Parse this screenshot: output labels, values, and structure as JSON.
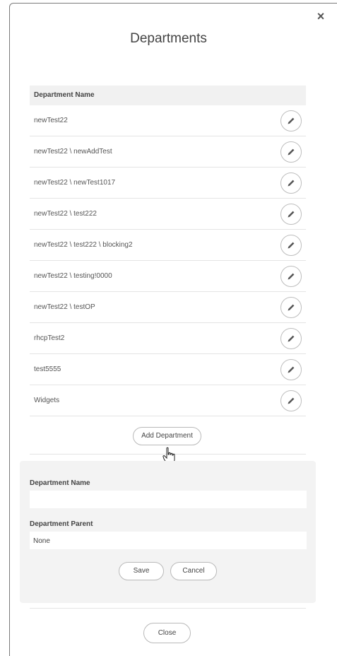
{
  "modal": {
    "title": "Departments",
    "close_icon": "close-x-icon"
  },
  "table": {
    "header": "Department Name",
    "rows": [
      {
        "name": "newTest22"
      },
      {
        "name": "newTest22 \\ newAddTest"
      },
      {
        "name": "newTest22 \\ newTest1017"
      },
      {
        "name": "newTest22 \\ test222"
      },
      {
        "name": "newTest22 \\ test222 \\ blocking2"
      },
      {
        "name": "newTest22 \\ testing!0000"
      },
      {
        "name": "newTest22 \\ testOP"
      },
      {
        "name": "rhcpTest2"
      },
      {
        "name": "test5555"
      },
      {
        "name": "Widgets"
      }
    ],
    "edit_icon": "pencil-icon"
  },
  "actions": {
    "add_label": "Add Department"
  },
  "form": {
    "name_label": "Department Name",
    "name_value": "",
    "parent_label": "Department Parent",
    "parent_value": "None",
    "save_label": "Save",
    "cancel_label": "Cancel"
  },
  "footer": {
    "close_label": "Close"
  }
}
